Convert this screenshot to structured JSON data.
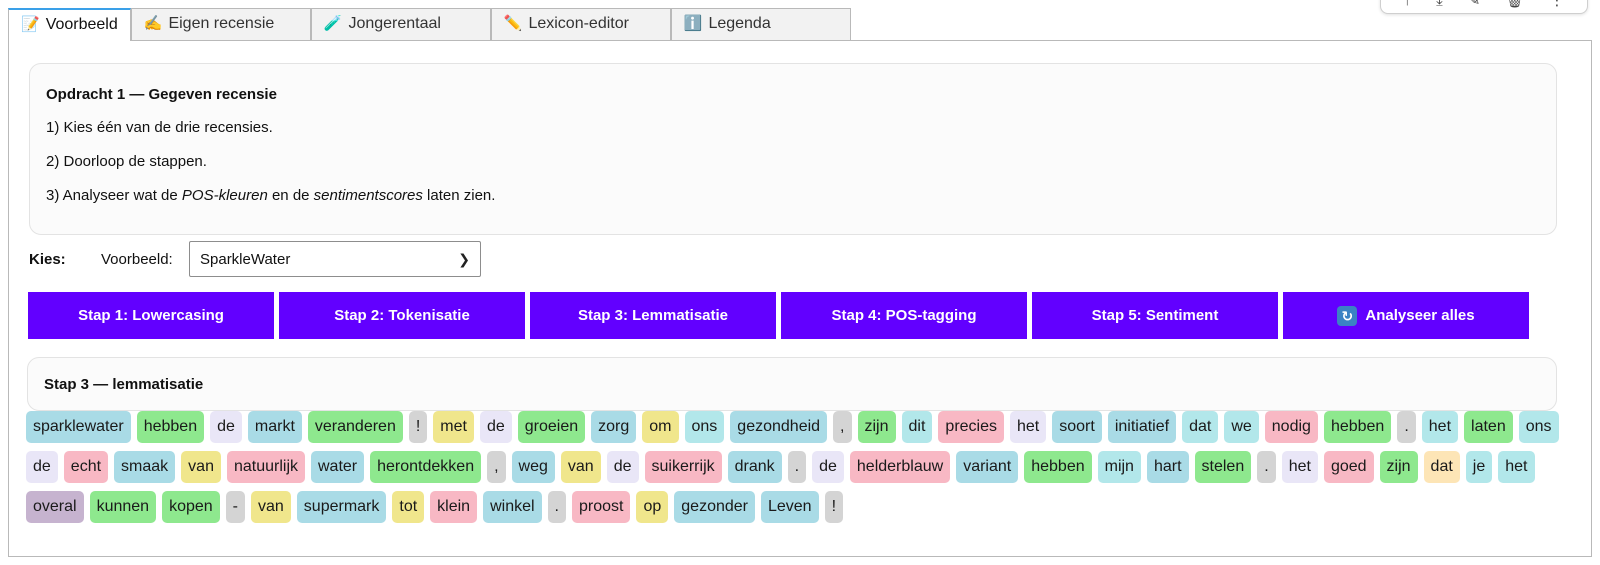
{
  "toolbar_icons": [
    "arrow-up-icon",
    "download-icon",
    "pencil-icon",
    "trash-icon",
    "more-icon"
  ],
  "tabs": [
    {
      "label": "Voorbeeld",
      "icon": "📝",
      "active": true
    },
    {
      "label": "Eigen recensie",
      "icon": "✍️",
      "active": false
    },
    {
      "label": "Jongerentaal",
      "icon": "🧪",
      "active": false
    },
    {
      "label": "Lexicon-editor",
      "icon": "✏️",
      "active": false
    },
    {
      "label": "Legenda",
      "icon": "ℹ️",
      "active": false
    }
  ],
  "assignment": {
    "title": "Opdracht 1 — Gegeven recensie",
    "line1": "1) Kies één van de drie recensies.",
    "line2": "2) Doorloop de stappen.",
    "line3_pre": "3) Analyseer wat de ",
    "line3_em1": "POS-kleuren",
    "line3_mid": " en de ",
    "line3_em2": "sentimentscores",
    "line3_post": " laten zien."
  },
  "choose": {
    "label": "Kies:",
    "select_label": "Voorbeeld:",
    "selected": "SparkleWater"
  },
  "steps": [
    "Stap 1: Lowercasing",
    "Stap 2: Tokenisatie",
    "Stap 3: Lemmatisatie",
    "Stap 4: POS-tagging",
    "Stap 5: Sentiment",
    "Analyseer alles"
  ],
  "result": {
    "title": "Stap 3 — lemmatisatie"
  },
  "pos_colors": {
    "noun": "#a9dbe6",
    "verb": "#8ee88e",
    "det": "#e9e6f7",
    "punct": "#d4d4d4",
    "adp": "#f0e68c",
    "adj": "#f8b8c4",
    "pron": "#b2e7ea",
    "sconj": "#fde5b6",
    "adv": "#c6b3cf"
  },
  "tokens": [
    {
      "t": "sparklewater",
      "p": "noun"
    },
    {
      "t": "hebben",
      "p": "verb"
    },
    {
      "t": "de",
      "p": "det"
    },
    {
      "t": "markt",
      "p": "noun"
    },
    {
      "t": "veranderen",
      "p": "verb"
    },
    {
      "t": "!",
      "p": "punct"
    },
    {
      "t": "met",
      "p": "adp"
    },
    {
      "t": "de",
      "p": "det"
    },
    {
      "t": "groeien",
      "p": "verb"
    },
    {
      "t": "zorg",
      "p": "noun"
    },
    {
      "t": "om",
      "p": "adp"
    },
    {
      "t": "ons",
      "p": "pron"
    },
    {
      "t": "gezondheid",
      "p": "noun"
    },
    {
      "t": ",",
      "p": "punct"
    },
    {
      "t": "zijn",
      "p": "verb"
    },
    {
      "t": "dit",
      "p": "pron"
    },
    {
      "t": "precies",
      "p": "adj"
    },
    {
      "t": "het",
      "p": "det"
    },
    {
      "t": "soort",
      "p": "noun"
    },
    {
      "t": "initiatief",
      "p": "noun"
    },
    {
      "t": "dat",
      "p": "pron"
    },
    {
      "t": "we",
      "p": "pron"
    },
    {
      "t": "nodig",
      "p": "adj"
    },
    {
      "t": "hebben",
      "p": "verb"
    },
    {
      "t": ".",
      "p": "punct"
    },
    {
      "t": "het",
      "p": "pron"
    },
    {
      "t": "laten",
      "p": "verb"
    },
    {
      "t": "ons",
      "p": "pron"
    },
    {
      "t": "de",
      "p": "det"
    },
    {
      "t": "echt",
      "p": "adj"
    },
    {
      "t": "smaak",
      "p": "noun"
    },
    {
      "t": "van",
      "p": "adp"
    },
    {
      "t": "natuurlijk",
      "p": "adj"
    },
    {
      "t": "water",
      "p": "noun"
    },
    {
      "t": "herontdekken",
      "p": "verb"
    },
    {
      "t": ",",
      "p": "punct"
    },
    {
      "t": "weg",
      "p": "noun"
    },
    {
      "t": "van",
      "p": "adp"
    },
    {
      "t": "de",
      "p": "det"
    },
    {
      "t": "suikerrijk",
      "p": "adj"
    },
    {
      "t": "drank",
      "p": "noun"
    },
    {
      "t": ".",
      "p": "punct"
    },
    {
      "t": "de",
      "p": "det"
    },
    {
      "t": "helderblauw",
      "p": "adj"
    },
    {
      "t": "variant",
      "p": "noun"
    },
    {
      "t": "hebben",
      "p": "verb"
    },
    {
      "t": "mijn",
      "p": "pron"
    },
    {
      "t": "hart",
      "p": "noun"
    },
    {
      "t": "stelen",
      "p": "verb"
    },
    {
      "t": ".",
      "p": "punct"
    },
    {
      "t": "het",
      "p": "det"
    },
    {
      "t": "goed",
      "p": "adj"
    },
    {
      "t": "zijn",
      "p": "verb"
    },
    {
      "t": "dat",
      "p": "sconj"
    },
    {
      "t": "je",
      "p": "pron"
    },
    {
      "t": "het",
      "p": "pron"
    },
    {
      "t": "overal",
      "p": "adv"
    },
    {
      "t": "kunnen",
      "p": "verb"
    },
    {
      "t": "kopen",
      "p": "verb"
    },
    {
      "t": "-",
      "p": "punct"
    },
    {
      "t": "van",
      "p": "adp"
    },
    {
      "t": "supermark",
      "p": "noun"
    },
    {
      "t": "tot",
      "p": "adp"
    },
    {
      "t": "klein",
      "p": "adj"
    },
    {
      "t": "winkel",
      "p": "noun"
    },
    {
      "t": ".",
      "p": "punct"
    },
    {
      "t": "proost",
      "p": "adj"
    },
    {
      "t": "op",
      "p": "adp"
    },
    {
      "t": "gezonder",
      "p": "noun"
    },
    {
      "t": "Leven",
      "p": "noun"
    },
    {
      "t": "!",
      "p": "punct"
    }
  ]
}
